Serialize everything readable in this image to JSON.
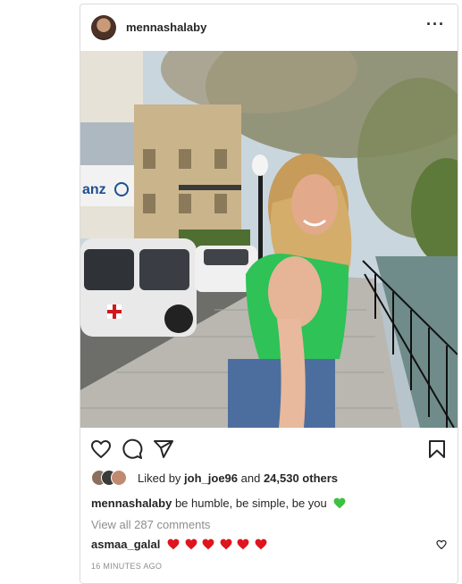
{
  "post": {
    "username": "mennashalaby",
    "more_label": "···",
    "likes": {
      "prefix": "Liked by ",
      "first_user": "joh_joe96",
      "middle": " and ",
      "count_text": "24,530 others"
    },
    "caption": {
      "user": "mennashalaby",
      "text": " be humble, be simple, be you"
    },
    "view_comments": "View all 287 comments",
    "comment": {
      "user": "asmaa_galal",
      "heart_count": 6
    },
    "timestamp": "16 MINUTES AGO"
  },
  "photo_signs": {
    "building_sign": "anz"
  },
  "icons": {
    "like": "heart-outline-icon",
    "comment": "speech-bubble-icon",
    "share": "paper-plane-icon",
    "save": "bookmark-icon"
  },
  "colors": {
    "accent_heart": "#ed4956",
    "green_heart": "#3ec13e",
    "text": "#262626",
    "muted": "#8e8e8e",
    "border": "#dbdbdb"
  }
}
